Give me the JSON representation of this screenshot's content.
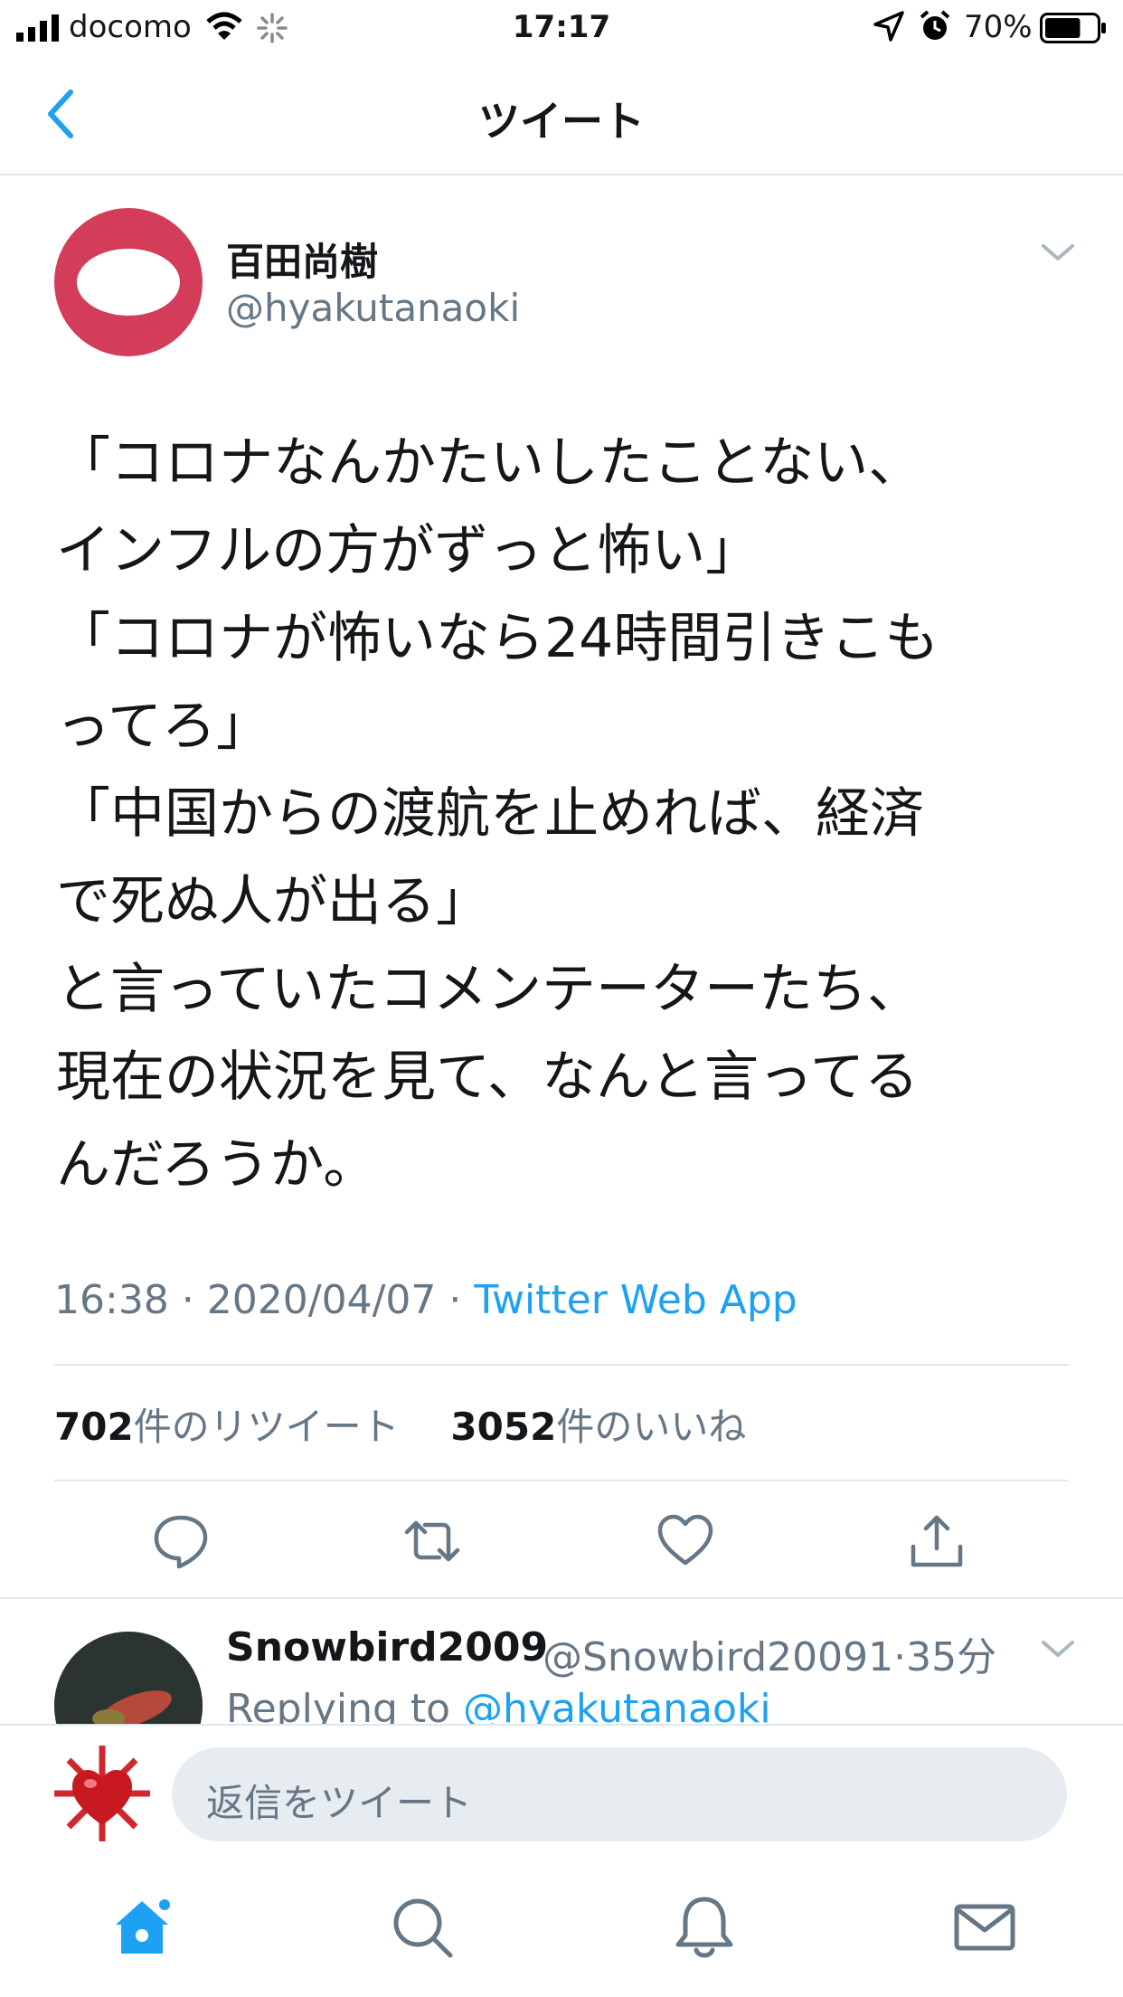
{
  "status_bar": {
    "carrier": "docomo",
    "time": "17:17",
    "battery_percent": "70%",
    "battery_level": 0.7
  },
  "nav": {
    "title": "ツイート",
    "back_icon": "chevron-left-icon"
  },
  "tweet": {
    "author_name": "百田尚樹",
    "author_handle": "@hyakutanaoki",
    "body": "「コロナなんかたいしたことない、\nインフルの方がずっと怖い」\n「コロナが怖いなら24時間引きこも\nってろ」\n「中国からの渡航を止めれば、経済\nで死ぬ人が出る」\nと言っていたコメンテーターたち、\n現在の状況を見て、なんと言ってる\nんだろうか。",
    "time": "16:38",
    "sep1": " · ",
    "date": "2020/04/07",
    "sep2": " · ",
    "source": "Twitter Web App",
    "retweet_count": "702",
    "retweet_label": "件のリツイート",
    "like_count": "3052",
    "like_label": "件のいいね"
  },
  "actions": [
    "reply-icon",
    "retweet-icon",
    "like-icon",
    "share-icon"
  ],
  "reply": {
    "name": "Snowbird2009",
    "handle": "@Snowbird20091",
    "sep": "·",
    "time_ago": "35分",
    "replying_prefix": "Replying to ",
    "replying_to": "@hyakutanaoki"
  },
  "compose": {
    "placeholder": "返信をツイート"
  },
  "tabs": [
    "home-icon",
    "search-icon",
    "notifications-icon",
    "messages-icon"
  ],
  "colors": {
    "accent": "#1da1f2",
    "avatar_red": "#d33d5a",
    "secondary_text": "#657786"
  }
}
